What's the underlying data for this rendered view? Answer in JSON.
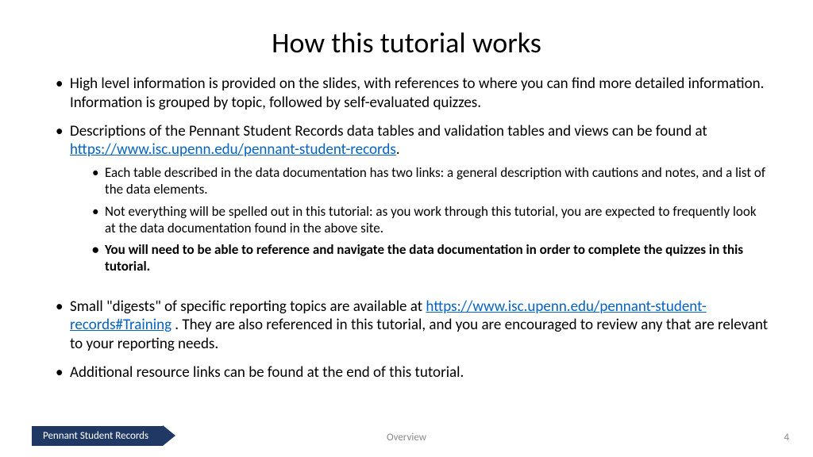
{
  "title": "How this tutorial works",
  "bullets": {
    "b1": "High level information is provided on the slides, with references to where you can find more detailed information.  Information is grouped by topic, followed by self-evaluated quizzes.",
    "b2_pre": "Descriptions of the Pennant Student Records data tables and validation tables and views can be found at ",
    "b2_link": "https://www.isc.upenn.edu/pennant-student-records",
    "b2_post": ".",
    "b2_sub1": "Each table described in the data documentation has two links: a general description with cautions and notes, and a list of the data elements.",
    "b2_sub2": "Not everything will be spelled out in this tutorial: as you work through this tutorial, you are expected to frequently look at the data documentation found in the above site.",
    "b2_sub3": "You will need to be able to reference and navigate the data documentation in order to complete the quizzes in this tutorial.",
    "b3_pre": "Small \"digests\" of specific reporting topics are available at ",
    "b3_link": "https://www.isc.upenn.edu/pennant-student-records#Training",
    "b3_post": " . They are also referenced in this tutorial, and you are encouraged to review any that are relevant to your reporting needs.",
    "b4": "Additional resource links can be found at the end of this tutorial."
  },
  "footer": {
    "breadcrumb": "Pennant Student Records",
    "center": "Overview",
    "page": "4"
  }
}
